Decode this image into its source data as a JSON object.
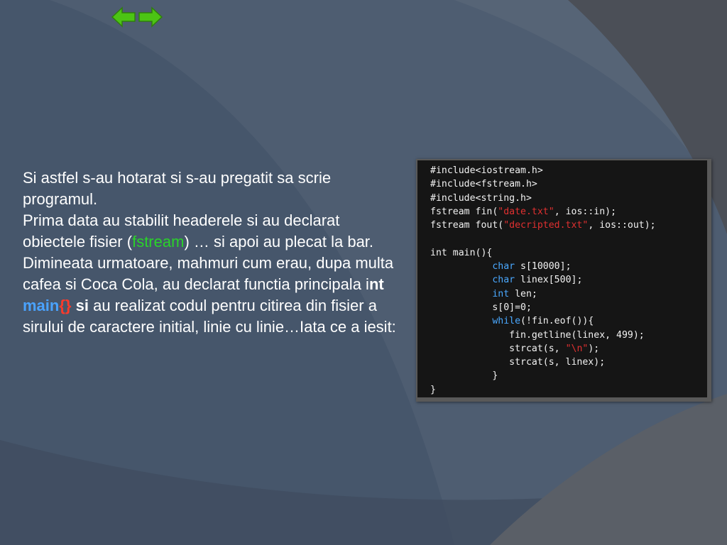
{
  "slide": {
    "nav": {
      "prev_icon": "arrow-left-icon",
      "next_icon": "arrow-right-icon",
      "arrow_color": "#4cc414"
    },
    "text": {
      "p1": "Si astfel s-au hotarat si s-au pregatit sa scrie programul.",
      "p2_before": "Prima data au stabilit headerele si au declarat obiectele fisier (",
      "p2_highlight": "fstream",
      "p2_after": ") … si apoi au plecat la bar.",
      "p3_before": "Dimineata urmatoare, mahmuri cum erau, dupa multa cafea si Coca Cola, au declarat functia principala i",
      "p3_nt": "nt",
      "p3_main": "main",
      "p3_braces": "{}",
      "p3_si": "si",
      "p3_after": " au realizat codul pentru citirea din fisier a sirului de caractere initial, linie cu linie…Iata ce a iesit:"
    },
    "code": {
      "line1": "#include<iostream.h>",
      "line2": "#include<fstream.h>",
      "line3": "#include<string.h>",
      "line4_a": "fstream fin(",
      "line4_str": "\"date.txt\"",
      "line4_b": ", ios::in);",
      "line5_a": "fstream fout(",
      "line5_str": "\"decripted.txt\"",
      "line5_b": ", ios::out);",
      "line7": "int main(){",
      "line8_kw": "char",
      "line8_rest": " s[10000];",
      "line9_kw": "char",
      "line9_rest": " linex[500];",
      "line10_kw": "int",
      "line10_rest": " len;",
      "line11": "s[0]=0;",
      "line12_kw": "while",
      "line12_rest": "(!fin.eof()){",
      "line13": "fin.getline(linex, 499);",
      "line14_a": "strcat(s, ",
      "line14_str": "\"\\n\"",
      "line14_b": ");",
      "line15": "strcat(s, linex);",
      "line16": "}",
      "line17": "}"
    },
    "colors": {
      "background": "#46566b",
      "text": "#ffffff",
      "highlight_green": "#2ad22a",
      "keyword_blue": "#4aa8ff",
      "string_red": "#e03030",
      "code_bg": "#151515"
    }
  }
}
